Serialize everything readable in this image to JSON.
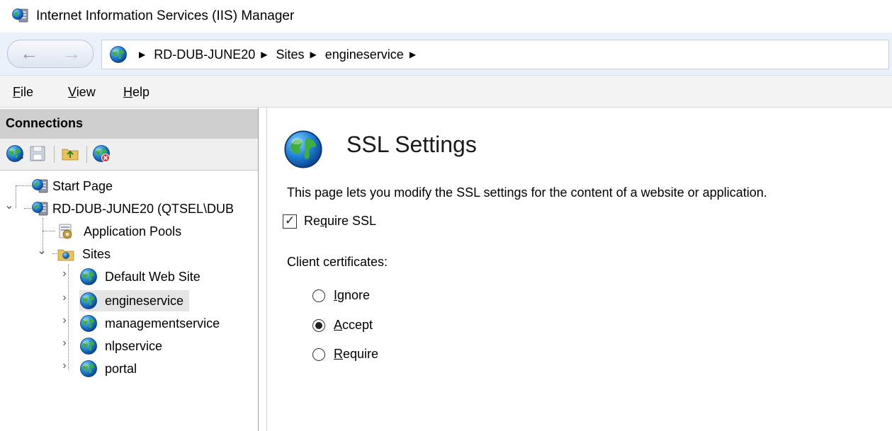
{
  "window": {
    "title": "Internet Information Services (IIS) Manager"
  },
  "address": {
    "back_glyph": "←",
    "forward_glyph": "→",
    "separator_glyph": "▶",
    "crumbs": [
      "RD-DUB-JUNE20",
      "Sites",
      "engineservice"
    ]
  },
  "menu": {
    "file": {
      "mnemonic": "F",
      "rest": "ile"
    },
    "view": {
      "mnemonic": "V",
      "rest": "iew"
    },
    "help": {
      "mnemonic": "H",
      "rest": "elp"
    }
  },
  "connections": {
    "header": "Connections",
    "tree": {
      "start_page": "Start Page",
      "server": "RD-DUB-JUNE20 (QTSEL\\DUB",
      "app_pools": "Application Pools",
      "sites": "Sites",
      "site_list": [
        "Default Web Site",
        "engineservice",
        "managementservice",
        "nlpservice",
        "portal"
      ],
      "expand_glyph": "›",
      "collapse_glyph": "⌄"
    }
  },
  "content": {
    "title": "SSL Settings",
    "description": "This page lets you modify the SSL settings for the content of a website or application.",
    "require_ssl": {
      "before": "Re",
      "mnemonic": "q",
      "after": "uire SSL",
      "checked": true,
      "tick": "✓"
    },
    "client_certificates_label": "Client certificates:",
    "options": [
      {
        "mnemonic": "I",
        "rest": "gnore",
        "checked": false
      },
      {
        "mnemonic": "A",
        "rest": "ccept",
        "checked": true
      },
      {
        "mnemonic": "R",
        "rest": "equire",
        "checked": false
      }
    ]
  },
  "colors": {
    "address_bar_bg": "#eaf1fb",
    "connections_header_bg": "#cfcfcf",
    "selected_item_bg": "#e5e5e5"
  }
}
